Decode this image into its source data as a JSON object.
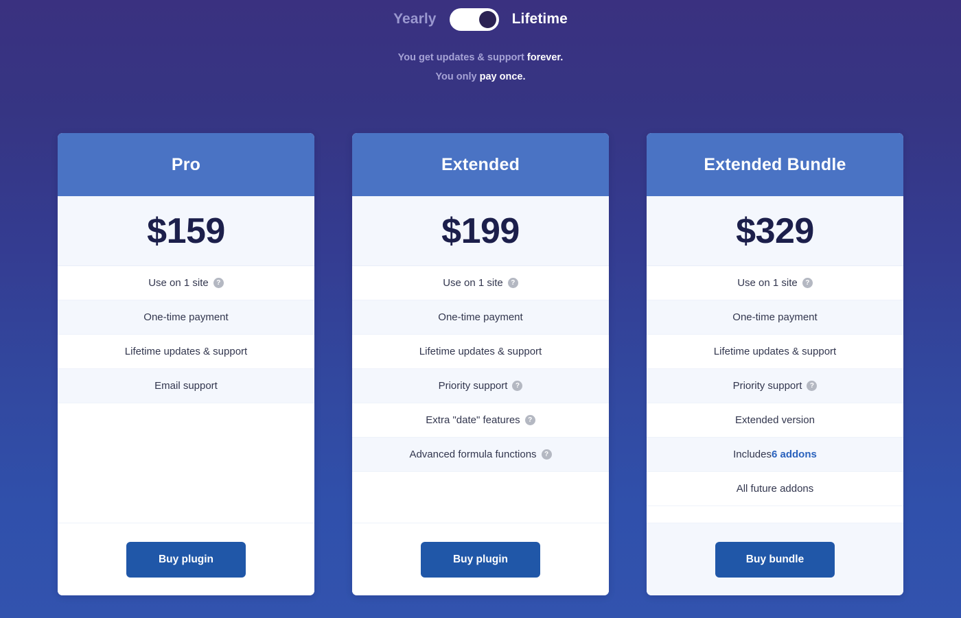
{
  "billing": {
    "yearly_label": "Yearly",
    "lifetime_label": "Lifetime",
    "toggle_state": "lifetime",
    "tagline_line1_prefix": "You get updates & support ",
    "tagline_line1_strong": "forever.",
    "tagline_line2_prefix": "You only ",
    "tagline_line2_strong": "pay once."
  },
  "colors": {
    "card_header": "#4a73c4",
    "buy_button": "#2057a8",
    "price_text": "#1c1f4b",
    "link": "#2a62bd",
    "row_alt": "#f4f7fd",
    "bg_top": "#3a3180",
    "bg_bottom": "#3253ae"
  },
  "plans": [
    {
      "name": "Pro",
      "price": "$159",
      "features": [
        {
          "text": "Use on 1 site",
          "help": true
        },
        {
          "text": "One-time payment",
          "help": false
        },
        {
          "text": "Lifetime updates & support",
          "help": false
        },
        {
          "text": "Email support",
          "help": false
        }
      ],
      "cta": "Buy plugin"
    },
    {
      "name": "Extended",
      "price": "$199",
      "features": [
        {
          "text": "Use on 1 site",
          "help": true
        },
        {
          "text": "One-time payment",
          "help": false
        },
        {
          "text": "Lifetime updates & support",
          "help": false
        },
        {
          "text": "Priority support",
          "help": true
        },
        {
          "text": "Extra \"date\" features",
          "help": true
        },
        {
          "text": "Advanced formula functions",
          "help": true
        }
      ],
      "cta": "Buy plugin"
    },
    {
      "name": "Extended Bundle",
      "price": "$329",
      "features": [
        {
          "text": "Use on 1 site",
          "help": true
        },
        {
          "text": "One-time payment",
          "help": false
        },
        {
          "text": "Lifetime updates & support",
          "help": false
        },
        {
          "text": "Priority support",
          "help": true
        },
        {
          "text": "Extended version",
          "help": false
        },
        {
          "text": "Includes ",
          "link": "6 addons",
          "help": false
        },
        {
          "text": "All future addons",
          "help": false
        }
      ],
      "cta": "Buy bundle"
    }
  ],
  "icons": {
    "help": "?"
  }
}
